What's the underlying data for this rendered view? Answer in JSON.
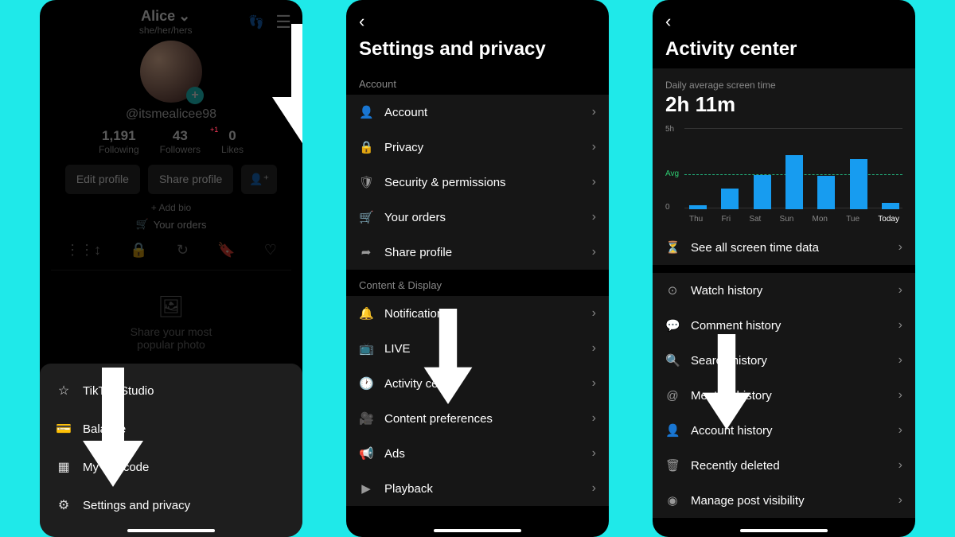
{
  "screen1": {
    "name": "Alice",
    "pronouns": "she/her/hers",
    "handle": "@itsmealicee98",
    "stats": {
      "following_n": "1,191",
      "following_l": "Following",
      "followers_n": "43",
      "followers_l": "Followers",
      "likes_n": "0",
      "likes_l": "Likes",
      "followers_delta": "+1"
    },
    "buttons": {
      "edit": "Edit profile",
      "share": "Share profile"
    },
    "addbio": "+ Add bio",
    "orders": "Your orders",
    "empty": {
      "line1": "Share your most",
      "line2": "popular photo"
    },
    "sheet": {
      "studio": "TikTok Studio",
      "balance": "Balance",
      "qrcode": "My QR code",
      "settings": "Settings and privacy"
    }
  },
  "screen2": {
    "title": "Settings and privacy",
    "sections": {
      "account_label": "Account",
      "content_label": "Content & Display"
    },
    "rows": {
      "account": "Account",
      "privacy": "Privacy",
      "security": "Security & permissions",
      "orders": "Your orders",
      "share": "Share profile",
      "notifications": "Notifications",
      "live": "LIVE",
      "activity": "Activity center",
      "contentpref": "Content preferences",
      "ads": "Ads",
      "playback": "Playback"
    }
  },
  "screen3": {
    "title": "Activity center",
    "subtitle": "Daily average screen time",
    "avg_value": "2h 11m",
    "ylabels": {
      "top": "5h",
      "bottom": "0"
    },
    "avg_label": "Avg",
    "seeall": "See all screen time data",
    "rows": {
      "watch": "Watch history",
      "comment": "Comment history",
      "search": "Search history",
      "mention": "Mention history",
      "account": "Account history",
      "deleted": "Recently deleted",
      "visibility": "Manage post visibility"
    },
    "chart_data": {
      "type": "bar",
      "ylim": [
        0,
        5
      ],
      "avg": 2.18,
      "categories": [
        "Thu",
        "Fri",
        "Sat",
        "Sun",
        "Mon",
        "Tue",
        "Today"
      ],
      "values": [
        0.25,
        1.3,
        2.15,
        3.4,
        2.1,
        3.15,
        0.4
      ]
    }
  }
}
